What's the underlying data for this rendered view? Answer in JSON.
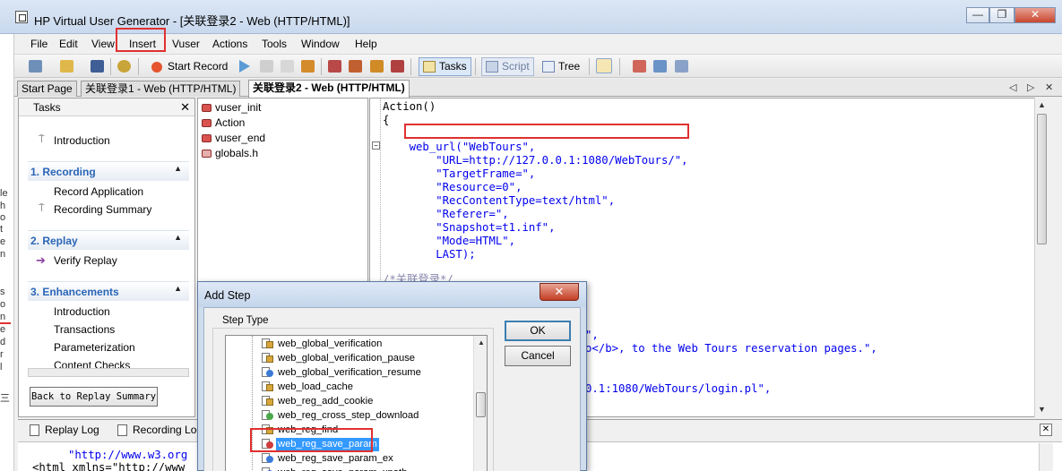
{
  "window": {
    "title": "HP Virtual User Generator - [关联登录2 - Web (HTTP/HTML)]",
    "minimize": "—",
    "restore": "❐",
    "close": "✕"
  },
  "menu": {
    "items": [
      "File",
      "Edit",
      "View",
      "Insert",
      "Vuser",
      "Actions",
      "Tools",
      "Window",
      "Help"
    ]
  },
  "toolbar": {
    "start_record": "Start Record",
    "tasks": "Tasks",
    "script": "Script",
    "tree": "Tree"
  },
  "doc_tabs": {
    "items": [
      "Start Page",
      "关联登录1 - Web (HTTP/HTML)",
      "关联登录2 - Web (HTTP/HTML)"
    ],
    "prev": "◁",
    "next": "▷",
    "close": "✕"
  },
  "left_strip": {
    "chars": [
      "le",
      "h",
      "o",
      "t",
      "e",
      "n",
      "s",
      "o",
      "n",
      "e",
      "d",
      "r",
      "l",
      "三"
    ]
  },
  "tasks": {
    "title": "Tasks",
    "close": "✕",
    "introduction": "Introduction",
    "sections": [
      {
        "label": "1. Recording",
        "items": [
          "Record Application",
          "Recording Summary"
        ]
      },
      {
        "label": "2. Replay",
        "items": [
          "Verify Replay"
        ]
      },
      {
        "label": "3. Enhancements",
        "items": [
          "Introduction",
          "Transactions",
          "Parameterization",
          "Content Checks"
        ]
      }
    ],
    "back_button": "Back to Replay Summary"
  },
  "script_tree": {
    "items": [
      "vuser_init",
      "Action",
      "vuser_end",
      "globals.h"
    ]
  },
  "editor": {
    "lines": [
      "Action()",
      "{",
      "    web_url(\"WebTours\",",
      "        \"URL=http://127.0.0.1:1080/WebTours/\",",
      "        \"TargetFrame=\",",
      "        \"Resource=0\",",
      "        \"RecContentType=text/html\",",
      "        \"Referer=\",",
      "        \"Snapshot=t1.inf\",",
      "        \"Mode=HTML\",",
      "        LAST);",
      "/*关联登录*/",
      "\",",
      "o</b>, to the Web Tours reservation pages.\",",
      "0.1:1080/WebTours/login.pl\","
    ]
  },
  "bottom": {
    "tabs": [
      "Replay Log",
      "Recording Log"
    ],
    "close": "✕",
    "lines": [
      "\"http://www.w3.org",
      "<html xmlns=\"http://www"
    ]
  },
  "dialog": {
    "title": "Add Step",
    "close": "✕",
    "group_label": "Step Type",
    "steps": [
      "web_global_verification",
      "web_global_verification_pause",
      "web_global_verification_resume",
      "web_load_cache",
      "web_reg_add_cookie",
      "web_reg_cross_step_download",
      "web_reg_find",
      "web_reg_save_param",
      "web_reg_save_param_ex",
      "web_reg_save_param_xpath"
    ],
    "selected_index": 7,
    "ok": "OK",
    "cancel": "Cancel"
  },
  "colors": {
    "highlight_red": "#e03030",
    "selection_blue": "#3399ff",
    "section_blue": "#2a66b6",
    "code_blue": "#0000ee"
  }
}
